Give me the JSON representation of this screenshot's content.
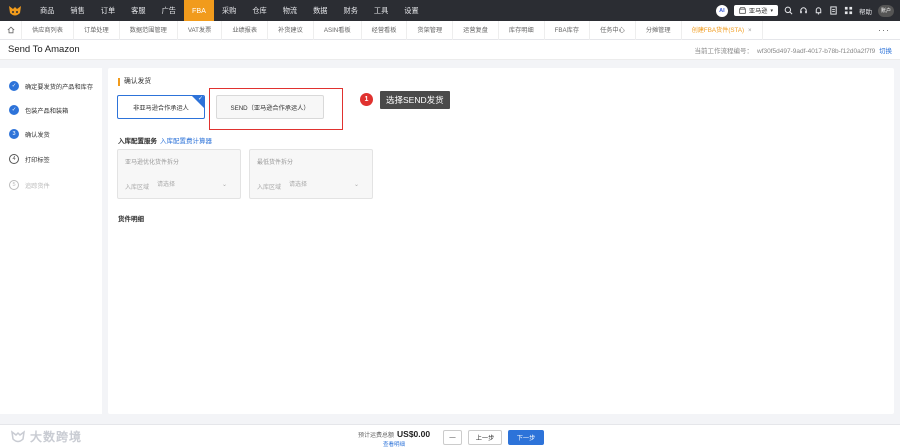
{
  "topnav": {
    "items": [
      "商品",
      "销售",
      "订单",
      "客服",
      "广告",
      "FBA",
      "采购",
      "仓库",
      "物流",
      "数据",
      "财务",
      "工具",
      "设置"
    ],
    "active_index": 5,
    "ai_label": "AI",
    "store_label": "亚马逊",
    "help_label": "帮助",
    "account_label": "账户"
  },
  "tabs": {
    "items": [
      "供应商列表",
      "订单处理",
      "数据范围管理",
      "VAT发票",
      "业绩报表",
      "补货建议",
      "ASIN看板",
      "经营看板",
      "货架管理",
      "运营复盘",
      "库存明细",
      "FBA库存",
      "任务中心",
      "分摊管理",
      "创建FBA货件(STA)"
    ],
    "active_index": 14,
    "close_glyph": "×",
    "more_glyph": "···"
  },
  "header": {
    "title": "Send To Amazon",
    "flow_id_label": "当前工作流程编号：",
    "flow_id_value": "wf30f5d497-9adf-4017-b78b-f12d0a2f7f9",
    "switch_label": "切换"
  },
  "steps": [
    {
      "label": "确定要发货的产品和库存",
      "marker": "✓",
      "state": "done"
    },
    {
      "label": "包装产品和装箱",
      "marker": "✓",
      "state": "done"
    },
    {
      "label": "确认发货",
      "marker": "3",
      "state": "current"
    },
    {
      "label": "打印标签",
      "marker": "4",
      "state": "todo"
    },
    {
      "label": "追踪货件",
      "marker": "5",
      "state": "future"
    }
  ],
  "main": {
    "section_title": "确认发货",
    "option_non_partnered": "非亚马逊合作承运人",
    "option_send": "SEND（亚马逊合作承运人）",
    "callout_number": "1",
    "callout_text": "选择SEND发货",
    "inbound_label": "入库配置服务",
    "inbound_link": "入库配置费计算器",
    "svc_optimized": {
      "title": "亚马逊优化货件拆分",
      "field_label": "入库区域",
      "placeholder": "请选择"
    },
    "svc_minimal": {
      "title": "最低货件拆分",
      "field_label": "入库区域",
      "placeholder": "请选择"
    },
    "detail_label": "货件明细"
  },
  "footer": {
    "watermark_text": "大数跨境",
    "fee_label": "预计运费总额",
    "fee_amount": "US$0.00",
    "fee_link": "查看明细",
    "minus_label": "—",
    "prev_label": "上一步",
    "next_label": "下一步"
  },
  "colors": {
    "nav_bg": "#2b2d33",
    "accent_orange": "#f19b1c",
    "primary_blue": "#2d73d9",
    "highlight_red": "#e0322f"
  }
}
